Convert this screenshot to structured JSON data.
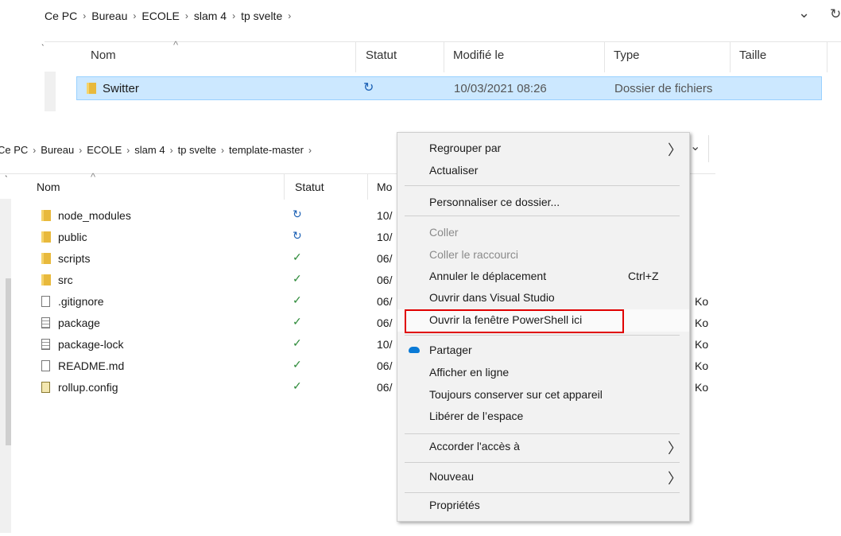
{
  "top_explorer": {
    "breadcrumb": [
      "Ce PC",
      "Bureau",
      "ECOLE",
      "slam 4",
      "tp svelte"
    ],
    "columns": {
      "name": "Nom",
      "status": "Statut",
      "modified": "Modifié le",
      "type": "Type",
      "size": "Taille"
    },
    "row": {
      "name": "Switter",
      "modified": "10/03/2021 08:26",
      "type": "Dossier de fichiers"
    }
  },
  "bottom_explorer": {
    "breadcrumb": [
      "Ce PC",
      "Bureau",
      "ECOLE",
      "slam 4",
      "tp svelte",
      "template-master"
    ],
    "columns": {
      "name": "Nom",
      "status": "Statut",
      "modified": "Mo"
    },
    "files": [
      {
        "name": "node_modules",
        "date": "10/",
        "size": ""
      },
      {
        "name": "public",
        "date": "10/",
        "size": ""
      },
      {
        "name": "scripts",
        "date": "06/",
        "size": ""
      },
      {
        "name": "src",
        "date": "06/",
        "size": ""
      },
      {
        "name": ".gitignore",
        "date": "06/",
        "size": "Ko"
      },
      {
        "name": "package",
        "date": "06/",
        "size": "Ko"
      },
      {
        "name": "package-lock",
        "date": "10/",
        "size": "Ko"
      },
      {
        "name": "README.md",
        "date": "06/",
        "size": "Ko"
      },
      {
        "name": "rollup.config",
        "date": "06/",
        "size": "Ko"
      }
    ]
  },
  "context_menu": {
    "group_by": "Regrouper par",
    "refresh": "Actualiser",
    "customize": "Personnaliser ce dossier...",
    "paste": "Coller",
    "paste_shortcut": "Coller le raccourci",
    "undo_move": "Annuler le déplacement",
    "undo_shortcut": "Ctrl+Z",
    "open_vs": "Ouvrir dans Visual Studio",
    "open_powershell": "Ouvrir la fenêtre PowerShell ici",
    "share": "Partager",
    "view_online": "Afficher en ligne",
    "always_keep": "Toujours conserver sur cet appareil",
    "free_space": "Libérer de l’espace",
    "give_access": "Accorder l'accès à",
    "new": "Nouveau",
    "properties": "Propriétés"
  },
  "icons": {
    "sync": "↻",
    "ok": "✓",
    "chevron": "›",
    "arrow": "〉",
    "dropdown": "⌄",
    "refresh": "↻",
    "sort_up": "^"
  },
  "colors": {
    "selection": "#cce8ff",
    "highlight_box": "#e00000",
    "sync": "#1a5fb4",
    "ok": "#2e8b3a"
  }
}
